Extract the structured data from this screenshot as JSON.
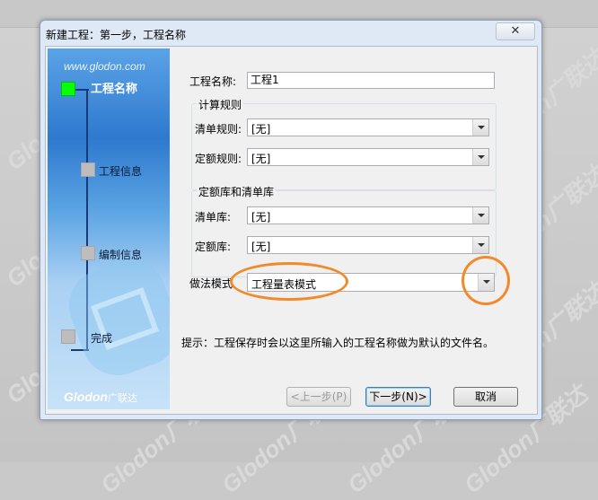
{
  "desktop": {
    "watermark": "Glodon广联达"
  },
  "window": {
    "title": "新建工程：第一步，工程名称",
    "close_icon": "close-icon"
  },
  "nav": {
    "url": "www.glodon.com",
    "steps": [
      {
        "label": "工程名称",
        "active": true
      },
      {
        "label": "工程信息",
        "active": false
      },
      {
        "label": "编制信息",
        "active": false
      },
      {
        "label": "完成",
        "active": false
      }
    ],
    "logo": "Glodon",
    "logo_cn": "广联达"
  },
  "form": {
    "project_name_label": "工程名称:",
    "project_name_value": "工程1",
    "calc_rules": {
      "title": "计算规则",
      "bill_label": "清单规则:",
      "bill_value": "[无]",
      "quota_label": "定额规则:",
      "quota_value": "[无]"
    },
    "libraries": {
      "title": "定额库和清单库",
      "bill_label": "清单库:",
      "bill_value": "[无]",
      "quota_label": "定额库:",
      "quota_value": "[无]"
    },
    "method_label": "做法模式",
    "method_value": "工程量表模式",
    "hint": "提示：工程保存时会以这里所输入的工程名称做为默认的文件名。"
  },
  "buttons": {
    "prev": "<上一步(P)",
    "next": "下一步(N)>",
    "cancel": "取消"
  },
  "colors": {
    "annotation": "#f2892a",
    "active_step": "#08ff08"
  }
}
